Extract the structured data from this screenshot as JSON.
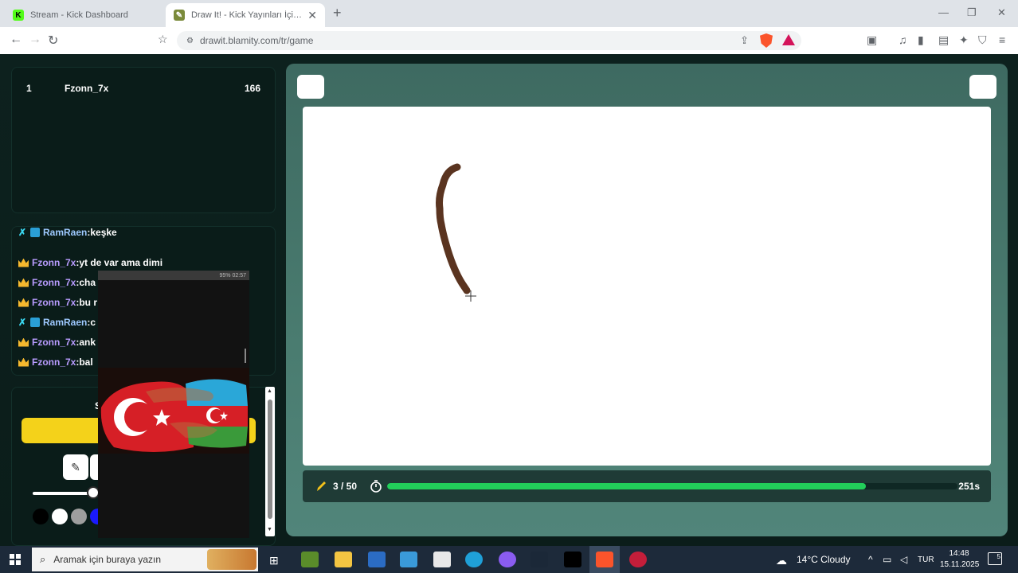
{
  "browser": {
    "tabs": [
      {
        "title": "Stream - Kick Dashboard",
        "active": false,
        "icon": "kick-icon"
      },
      {
        "title": "Draw It! - Kick Yayınları İçin Ç",
        "active": true,
        "icon": "drawit-icon"
      }
    ],
    "url": "drawit.blamity.com/tr/game"
  },
  "leaderboard": {
    "rows": [
      {
        "rank": "1",
        "name": "Fzonn_7x",
        "score": "166"
      }
    ]
  },
  "chat": {
    "messages": [
      {
        "user": "RamRaen",
        "text": "keşke",
        "badge": "sword"
      },
      {
        "user": "Fzonn_7x",
        "text": "yt de var ama dimi",
        "badge": "crown"
      },
      {
        "user": "Fzonn_7x",
        "text": "cha",
        "badge": "crown"
      },
      {
        "user": "Fzonn_7x",
        "text": "bu r",
        "badge": "crown"
      },
      {
        "user": "RamRaen",
        "text": "c",
        "badge": "sword"
      },
      {
        "user": "Fzonn_7x",
        "text": "ank",
        "badge": "crown"
      },
      {
        "user": "Fzonn_7x",
        "text": "bal",
        "badge": "crown"
      }
    ]
  },
  "tools": {
    "title": "S",
    "brush_size": 0.95,
    "colors": [
      "#000000",
      "#ffffff",
      "#9e9e9e",
      "#1a1aff"
    ],
    "accent": "#f4d21a"
  },
  "phone_overlay": {
    "status": "95% 02:57"
  },
  "game": {
    "round": "3 / 50",
    "time_left": "251s",
    "progress": 0.84,
    "stroke_color": "#5a3420",
    "progress_color": "#22cf5a"
  },
  "taskbar": {
    "search_placeholder": "Aramak için buraya yazın",
    "weather": "14°C  Cloudy",
    "lang": "TUR",
    "time": "14:48",
    "date": "15.11.2025",
    "notifications": "5"
  }
}
